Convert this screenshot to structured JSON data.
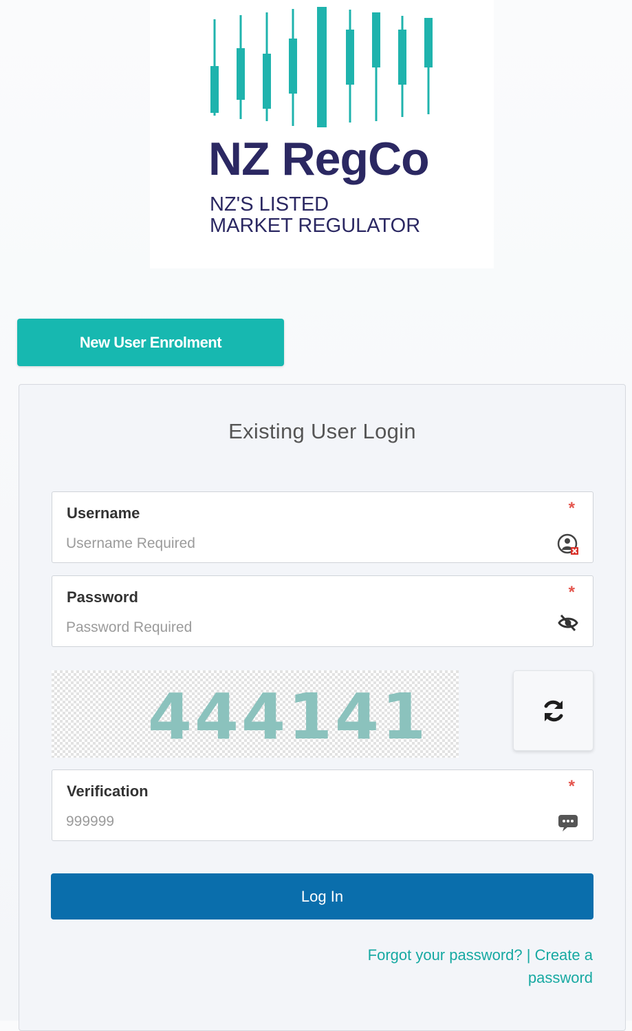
{
  "brand": {
    "name": "NZ RegCo",
    "tagline_line1": "NZ'S LISTED",
    "tagline_line2": "MARKET REGULATOR",
    "bar_color": "#1fb3ad",
    "text_color": "#2b2862"
  },
  "enrolment": {
    "label": "New User Enrolment"
  },
  "login_card": {
    "title": "Existing User Login",
    "username": {
      "label": "Username",
      "placeholder": "Username Required",
      "required_mark": "*",
      "icon": "user-error-icon"
    },
    "password": {
      "label": "Password",
      "placeholder": "Password Required",
      "required_mark": "*",
      "icon": "eye-slash-icon"
    },
    "captcha": {
      "code": "444141",
      "refresh_icon": "refresh-icon"
    },
    "verification": {
      "label": "Verification",
      "placeholder": "999999",
      "required_mark": "*",
      "icon": "message-icon"
    },
    "login_button": "Log In",
    "forgot_link": "Forgot your password?",
    "separator": "|",
    "create_link": "Create a password"
  },
  "colors": {
    "teal": "#17b8b0",
    "primary_blue": "#0a6eac",
    "required_red": "#e4554d"
  }
}
